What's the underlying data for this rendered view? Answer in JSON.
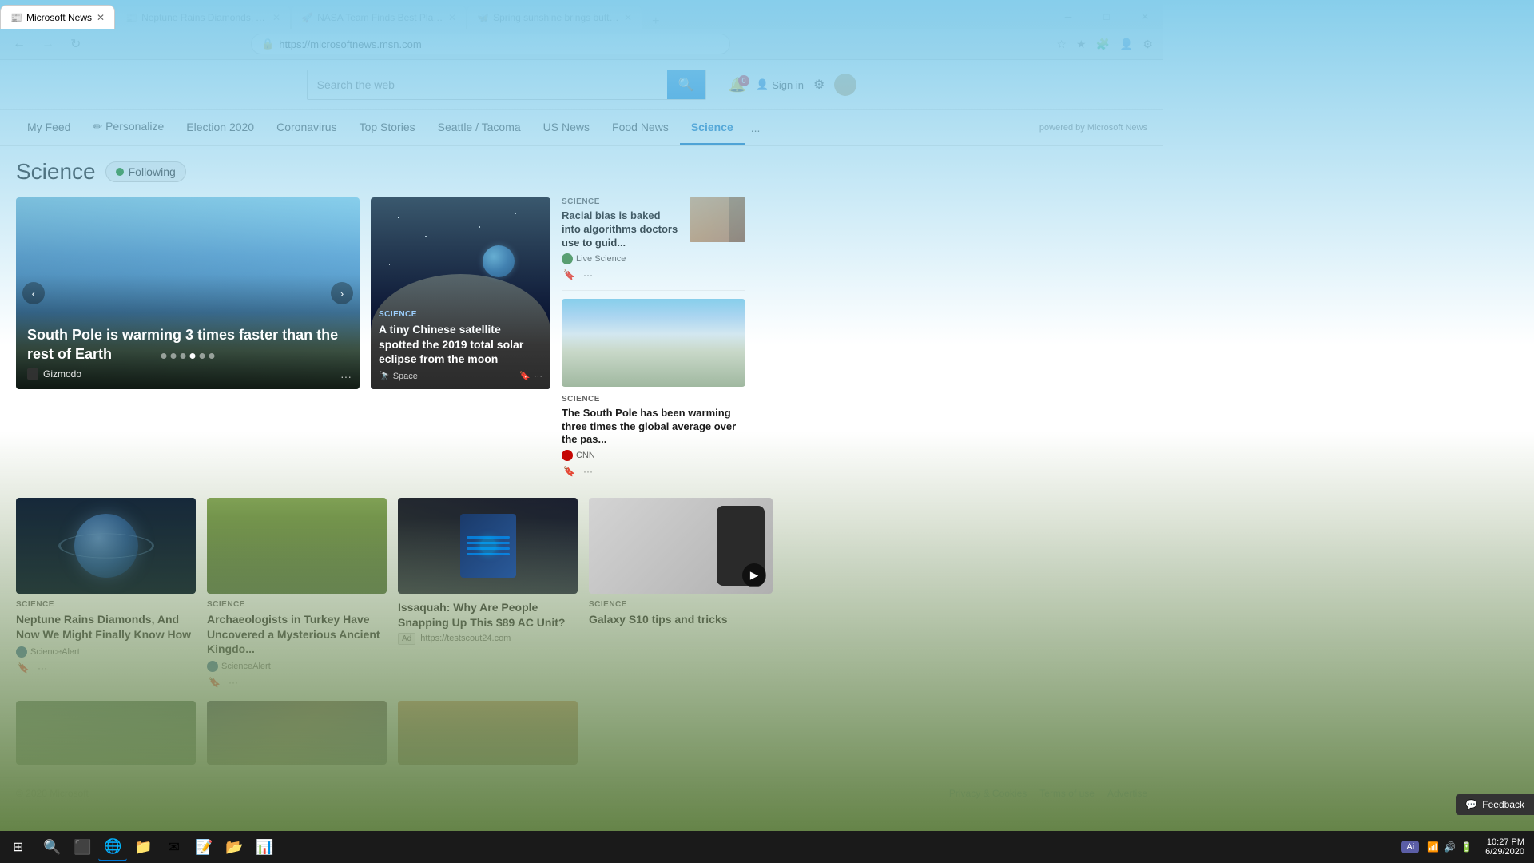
{
  "browser": {
    "tabs": [
      {
        "title": "Microsoft News",
        "url": "https://microsoftnews.msn.com",
        "active": true,
        "favicon": "📰"
      },
      {
        "title": "Neptune Rains Diamonds, And...",
        "url": "",
        "active": false,
        "favicon": "📰"
      },
      {
        "title": "NASA Team Finds Best Place Fo...",
        "url": "",
        "active": false,
        "favicon": "🚀"
      },
      {
        "title": "Spring sunshine brings butterfly...",
        "url": "",
        "active": false,
        "favicon": "🦋"
      }
    ],
    "address": "https://microsoftnews.msn.com"
  },
  "header": {
    "search_placeholder": "Search the web",
    "search_btn": "🔍",
    "notifications": "0",
    "sign_in": "Sign in",
    "powered_by": "powered by Microsoft News"
  },
  "nav": {
    "items": [
      {
        "label": "My Feed",
        "active": false
      },
      {
        "label": "✏ Personalize",
        "active": false
      },
      {
        "label": "Election 2020",
        "active": false
      },
      {
        "label": "Coronavirus",
        "active": false
      },
      {
        "label": "Top Stories",
        "active": false
      },
      {
        "label": "Seattle / Tacoma",
        "active": false
      },
      {
        "label": "US News",
        "active": false
      },
      {
        "label": "Food News",
        "active": false
      },
      {
        "label": "Science",
        "active": true
      }
    ],
    "more": "...",
    "powered_by": "powered by Microsoft News"
  },
  "page": {
    "title": "Science",
    "following_label": "Following"
  },
  "hero": {
    "title": "South Pole is warming 3 times faster than the rest of Earth",
    "source": "Gizmodo",
    "dots": 6,
    "active_dot": 3
  },
  "center_card": {
    "category": "SCIENCE",
    "title": "A tiny Chinese satellite spotted the 2019 total solar eclipse from the moon",
    "source": "Space",
    "source_icon": "🔭"
  },
  "right_cards": [
    {
      "category": "SCIENCE",
      "title": "Racial bias is baked into algorithms doctors use to guid...",
      "source": "Live Science",
      "source_icon": "🔬"
    },
    {
      "category": "SCIENCE",
      "title": "The South Pole has been warming three times the global average over the pas...",
      "source": "CNN",
      "source_icon": "📺"
    },
    {
      "category": "SCIENCE",
      "title": "Galaxy S10 tips and tricks",
      "source": "",
      "source_icon": "📱",
      "is_video": true
    }
  ],
  "article_cards": [
    {
      "category": "SCIENCE",
      "title": "Neptune Rains Diamonds, And Now We Might Finally Know How",
      "source": "ScienceAlert",
      "type": "neptune"
    },
    {
      "category": "SCIENCE",
      "title": "Archaeologists in Turkey Have Uncovered a Mysterious Ancient Kingdo...",
      "source": "ScienceAlert",
      "type": "grassland"
    }
  ],
  "ad_card": {
    "title": "Issaquah: Why Are People Snapping Up This $89 AC Unit?",
    "url": "https://testscout24.com",
    "ad_label": "Ad"
  },
  "bottom_cards": [
    {
      "type": "nature"
    },
    {
      "type": "meteor"
    },
    {
      "type": "copper"
    }
  ],
  "footer": {
    "copyright": "© 2020 Microsoft",
    "links": [
      "Privacy & Cookies",
      "Terms of use",
      "Advertise"
    ]
  },
  "feedback": {
    "label": "Feedback"
  },
  "taskbar": {
    "time": "10:27 PM",
    "date": "6/29/2020",
    "ai_label": "Ai"
  }
}
